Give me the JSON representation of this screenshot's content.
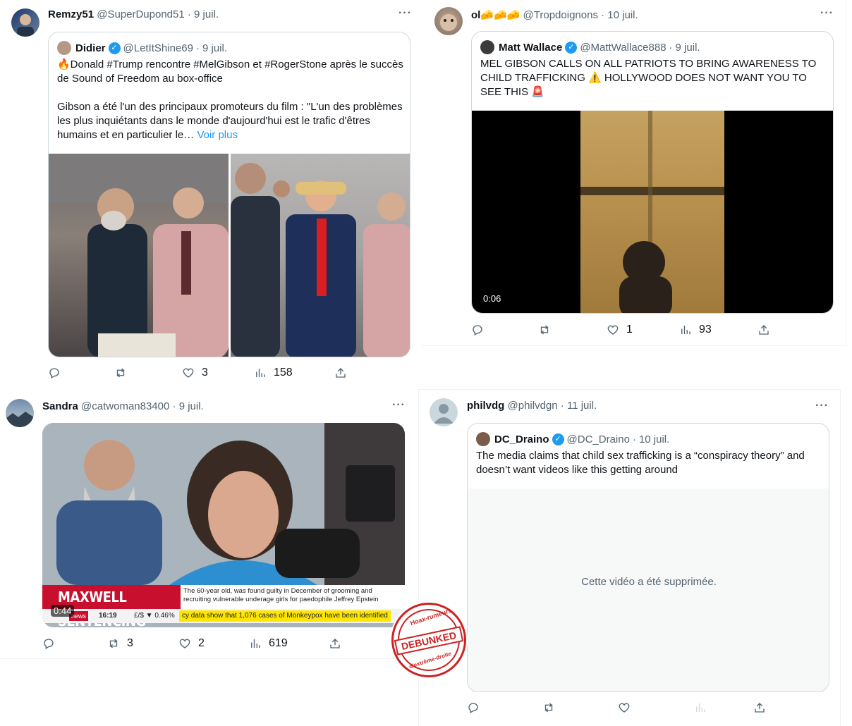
{
  "colors": {
    "accent": "#1d9bf0",
    "muted": "#536471",
    "border": "#cfd9de",
    "stamp": "#cc2222"
  },
  "tweets": [
    {
      "name": "Remzy51",
      "handle": "@SuperDupond51",
      "date": "9 juil.",
      "quote": {
        "name": "Didier",
        "handle": "@LetItShine69",
        "date": "9 juil.",
        "line1": "🔥Donald #Trump rencontre #MelGibson et #RogerStone après le succès de Sound of Freedom au box-office",
        "line2": "Gibson a été l'un des principaux promoteurs du film : \"L'un des problèmes les plus inquiétants dans le monde d'aujourd'hui est le trafic d'êtres humains et en particulier le…",
        "more": "Voir plus"
      },
      "stats": {
        "replies": "",
        "retweets": "",
        "likes": "3",
        "views": "158"
      }
    },
    {
      "name": "ol🧀🧀🧀",
      "handle": "@Tropdoignons",
      "date": "10 juil.",
      "quote": {
        "name": "Matt Wallace",
        "handle": "@MattWallace888",
        "date": "9 juil.",
        "text": "MEL GIBSON CALLS ON ALL PATRIOTS TO BRING AWARENESS TO CHILD TRAFFICKING ⚠️ HOLLYWOOD DOES NOT WANT YOU TO SEE THIS 🚨",
        "duration": "0:06"
      },
      "stats": {
        "replies": "",
        "retweets": "",
        "likes": "1",
        "views": "93"
      }
    },
    {
      "name": "Sandra",
      "handle": "@catwoman83400",
      "date": "9 juil.",
      "video": {
        "duration": "0:44",
        "banner": "MAXWELL SENTENCING",
        "caption": "The 60-year old, was found guilty in December of grooming and recruiting vulnerable underage girls for paedophile Jeffrey Epstein",
        "ticker_time": "16:19",
        "ticker_fx": "£/$ ▼ 0.46%",
        "ticker_text": "cy data show that 1,076 cases of Monkeypox have been identified",
        "channel": "news"
      },
      "stats": {
        "replies": "",
        "retweets": "3",
        "likes": "2",
        "views": "619"
      }
    },
    {
      "name": "philvdg",
      "handle": "@philvdgn",
      "date": "11 juil.",
      "quote": {
        "name": "DC_Draino",
        "handle": "@DC_Draino",
        "date": "10 juil.",
        "text": "The media claims that child sex trafficking is a “conspiracy theory” and doesn’t want videos like this getting around",
        "removed": "Cette vidéo a été supprimée."
      },
      "stats": {
        "replies": "",
        "retweets": "",
        "likes": "",
        "views": ""
      }
    }
  ],
  "stamp": {
    "top": "Hoax-rumeurs",
    "word": "DEBUNKED",
    "bottom": "d'extrême-droite"
  }
}
